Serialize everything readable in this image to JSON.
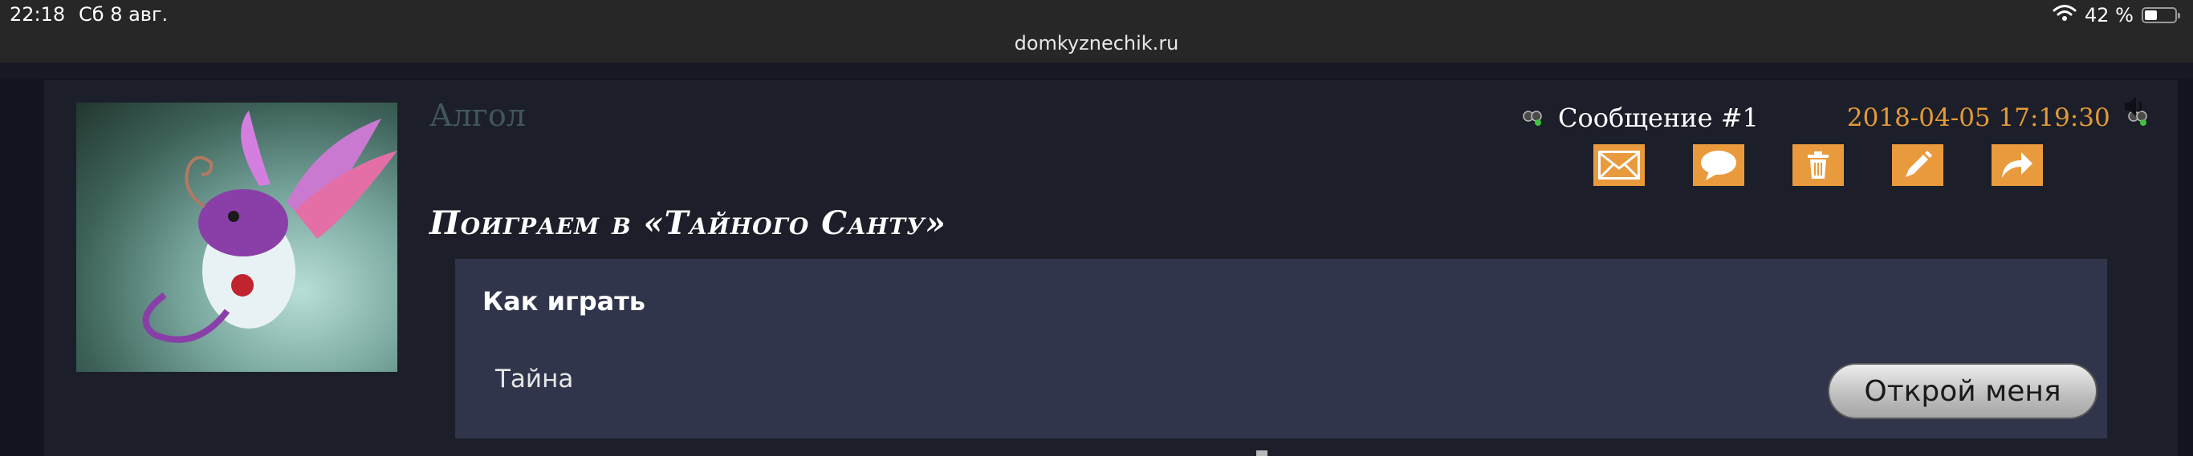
{
  "status_bar": {
    "time": "22:18",
    "date": "Сб 8 авг.",
    "battery": "42 %",
    "battery_level": 0.42
  },
  "browser": {
    "url": "domkyznechik.ru"
  },
  "post": {
    "author": "Алгол",
    "number": "Сообщение #1",
    "datetime": "2018-04-05 17:19:30",
    "title": "Поиграем в «Тайного Санту»",
    "actions": [
      "mail-icon",
      "comment-icon",
      "trash-icon",
      "pencil-icon",
      "share-arrow-icon"
    ],
    "spoiler": {
      "heading": "Как играть",
      "text": "Тайна",
      "button_label": "Открой меня"
    }
  },
  "colors": {
    "accent": "#e99a3d",
    "date": "#e59a37",
    "author": "#41565a",
    "spoiler_bg": "#30354b",
    "card_bg": "#1c1f29"
  }
}
